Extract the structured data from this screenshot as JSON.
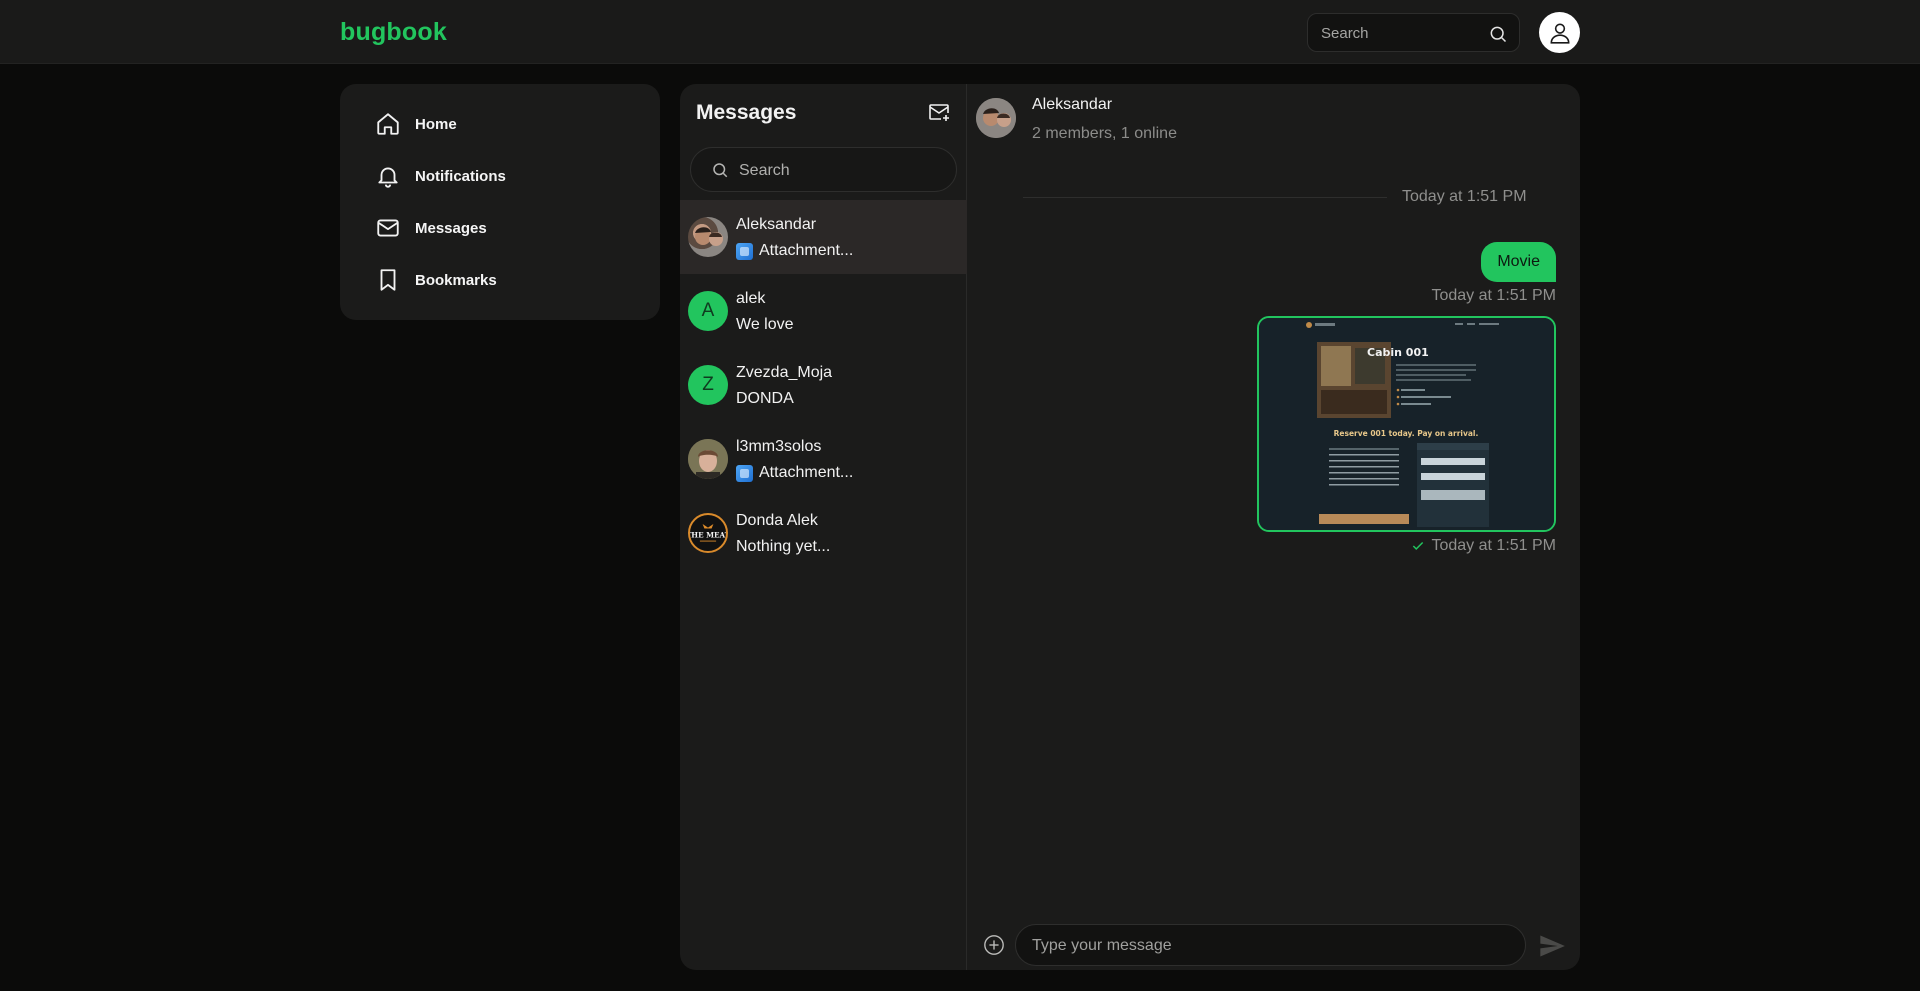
{
  "app": {
    "logo": "bugbook",
    "search_placeholder": "Search",
    "accent_color": "#22c55e"
  },
  "sidebar": {
    "items": [
      {
        "label": "Home",
        "icon": "home-icon"
      },
      {
        "label": "Notifications",
        "icon": "bell-icon"
      },
      {
        "label": "Messages",
        "icon": "mail-icon"
      },
      {
        "label": "Bookmarks",
        "icon": "bookmark-icon"
      }
    ]
  },
  "conversations": {
    "title": "Messages",
    "search_placeholder": "Search",
    "items": [
      {
        "name": "Aleksandar",
        "preview": "Attachment...",
        "avatar": "photo",
        "has_attachment": true,
        "active": true
      },
      {
        "name": "alek",
        "preview": "We love",
        "avatar_letter": "A"
      },
      {
        "name": "Zvezda_Moja",
        "preview": "DONDA",
        "avatar_letter": "Z"
      },
      {
        "name": "l3mm3solos",
        "preview": "Attachment...",
        "avatar": "photo",
        "has_attachment": true
      },
      {
        "name": "Donda Alek",
        "preview": "Nothing yet...",
        "avatar": "the-meat-logo"
      }
    ]
  },
  "chat": {
    "header_name": "Aleksandar",
    "header_sub": "2 members, 1 online",
    "date_divider": "Today at 1:51 PM",
    "messages": [
      {
        "text": "Movie",
        "time": "Today at 1:51 PM"
      },
      {
        "type": "image",
        "time": "Today at 1:51 PM",
        "status": "sent",
        "image_content": {
          "heading": "Cabin 001",
          "tagline": "Reserve 001 today. Pay on arrival."
        }
      }
    ],
    "composer_placeholder": "Type your message"
  },
  "logo_text": {
    "the_meat": "THE MEAT"
  }
}
